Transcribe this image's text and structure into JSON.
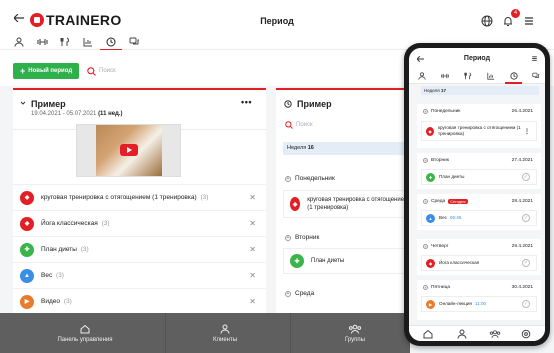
{
  "colors": {
    "brand": "#e31e24",
    "success": "#2eb04a",
    "workout": "#e31e24",
    "yoga": "#e31e24",
    "diet": "#3bb54a",
    "weight": "#3a8ee6",
    "video": "#e97b2c",
    "online": "#e97b2c",
    "nav_bg": "#5f5f5f"
  },
  "app": {
    "logo": "TRAINERO",
    "title": "Период",
    "notifications_count": "4"
  },
  "tabs": [
    "user-icon",
    "dumbbell-icon",
    "fork-knife-icon",
    "chart-icon",
    "clock-icon",
    "chat-icon"
  ],
  "toolbar": {
    "new_button": "Новый период",
    "search_placeholder": "Поиск"
  },
  "left_card": {
    "title": "Пример",
    "dates": "19.04.2021 - 05.07.2021",
    "weeks": "(11 нед.)",
    "items": [
      {
        "label": "круговая тренировка с отягощением (1 тренировка)",
        "count": "(3)",
        "icon": "workout"
      },
      {
        "label": "Йога классическая",
        "count": "(3)",
        "icon": "yoga"
      },
      {
        "label": "План диеты",
        "count": "(3)",
        "icon": "diet"
      },
      {
        "label": "Вес",
        "count": "(3)",
        "icon": "weight"
      },
      {
        "label": "Видео",
        "count": "(3)",
        "icon": "video"
      }
    ]
  },
  "mid_card": {
    "title": "Пример",
    "search_placeholder": "Поиск",
    "week": "Неделя",
    "week_num": "16",
    "days": [
      {
        "label": "Понедельник",
        "item": "круговая тренировка с отягощением (1 тренировка)"
      },
      {
        "label": "Вторник",
        "item": "План диеты"
      },
      {
        "label": "Среда"
      }
    ]
  },
  "bottom_nav": [
    "Панель управления",
    "Клиенты",
    "Группы"
  ],
  "phone": {
    "title": "Период",
    "week": "Неделя",
    "week_num": "17",
    "days": [
      {
        "label": "Понедельник",
        "date": "26.4.2021",
        "items": [
          {
            "label": "круговая тренировка с отягощением (1 тренировка)"
          }
        ]
      },
      {
        "label": "Вторник",
        "date": "27.4.2021",
        "items": [
          {
            "label": "План диеты"
          }
        ]
      },
      {
        "label": "Среда",
        "tag": "Сегодня",
        "date": "28.4.2021",
        "items": [
          {
            "label": "Вес",
            "time": "06:45"
          }
        ]
      },
      {
        "label": "Четверг",
        "date": "29.4.2021",
        "items": [
          {
            "label": "Йога классическая"
          }
        ]
      },
      {
        "label": "Пятница",
        "date": "30.4.2021",
        "items": [
          {
            "label": "Онлайн-лекция",
            "time": "11:00"
          }
        ]
      }
    ]
  }
}
